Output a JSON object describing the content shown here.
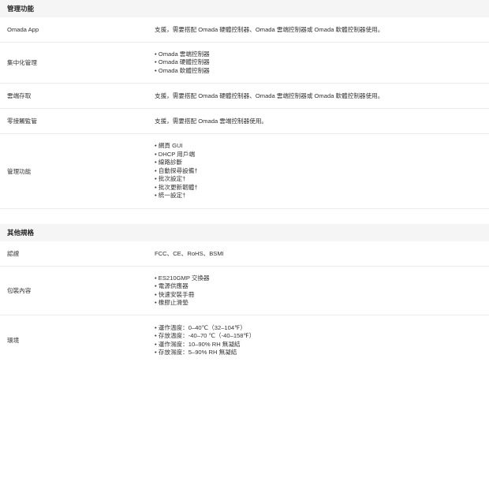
{
  "management": {
    "title": "管理功能",
    "rows": [
      {
        "label": "Omada App",
        "value": "支援，需要搭配 Omada 硬體控制器、Omada 雲端控制器或 Omada 軟體控制器使用。"
      },
      {
        "label": "集中化管理",
        "items": [
          "Omada 雲端控制器",
          "Omada 硬體控制器",
          "Omada 軟體控制器"
        ]
      },
      {
        "label": "雲端存取",
        "value": "支援，需要搭配 Omada 硬體控制器、Omada 雲端控制器或 Omada 軟體控制器使用。"
      },
      {
        "label": "零接觸監管",
        "value": "支援，需要搭配 Omada 雲端控制器使用。"
      },
      {
        "label": "管理功能",
        "items": [
          "網頁 GUI",
          "DHCP 用戶端",
          "線路診斷",
          "自動探尋設備†",
          "批次設定†",
          "批次更新韌體†",
          "統一設定†"
        ]
      }
    ]
  },
  "other": {
    "title": "其他規格",
    "rows": [
      {
        "label": "認證",
        "value": "FCC、CE、RoHS、BSMI"
      },
      {
        "label": "包裝內容",
        "items": [
          "ES210GMP 交換器",
          "電源供應器",
          "快速安裝手冊",
          "橡膠止滑墊"
        ]
      },
      {
        "label": "環境",
        "items": [
          "運作溫度：0–40℃（32–104℉）",
          "存放溫度：-40–70 ℃（-40–158℉）",
          "運作濕度：10–90% RH 無凝結",
          "存放濕度：5–90% RH 無凝結"
        ]
      }
    ]
  }
}
